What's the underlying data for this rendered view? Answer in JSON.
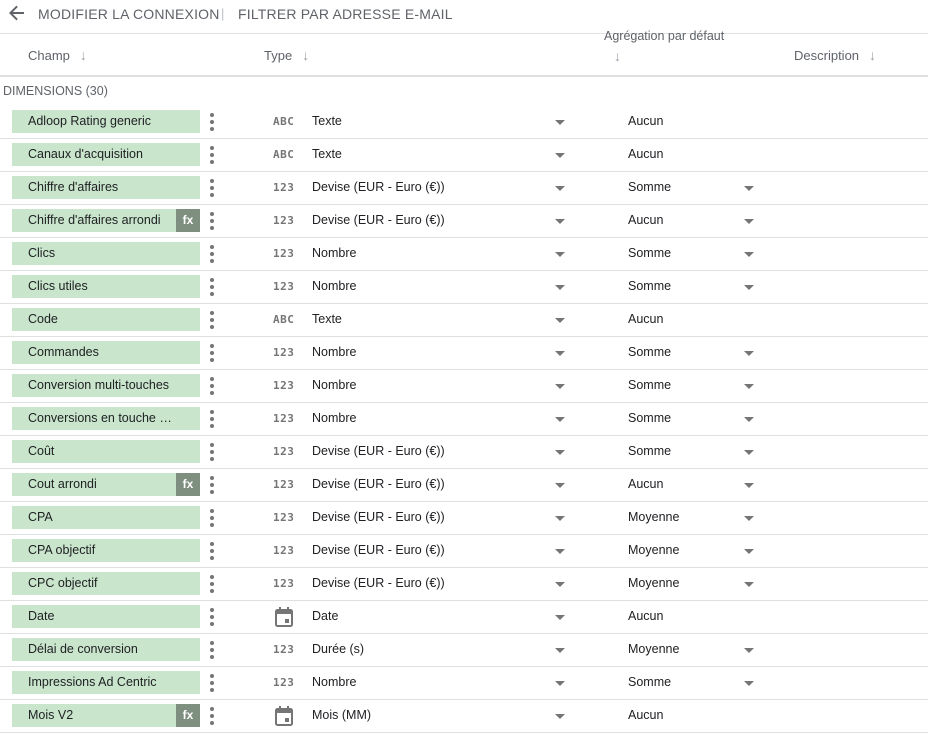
{
  "topbar": {
    "back_icon": "arrow-left-icon",
    "edit_connection": "MODIFIER LA CONNEXION",
    "separator": "|",
    "filter_email": "FILTRER PAR ADRESSE E-MAIL"
  },
  "columns": {
    "field": "Champ",
    "type": "Type",
    "aggregation": "Agrégation par défaut",
    "description": "Description",
    "sort_icon": "↓"
  },
  "section_label": "DIMENSIONS (30)",
  "colors": {
    "chip": "#c9e6cc",
    "fx_badge": "#7e8f80"
  },
  "rows": [
    {
      "field": "Adloop Rating generic",
      "fx": "",
      "icon": "ABC",
      "type": "Texte",
      "agg": "Aucun",
      "agg_dropdown": false
    },
    {
      "field": "Canaux d'acquisition",
      "fx": "",
      "icon": "ABC",
      "type": "Texte",
      "agg": "Aucun",
      "agg_dropdown": false
    },
    {
      "field": "Chiffre d'affaires",
      "fx": "",
      "icon": "123",
      "type": "Devise (EUR - Euro (€))",
      "agg": "Somme",
      "agg_dropdown": true
    },
    {
      "field": "Chiffre d'affaires arrondi",
      "fx": "fx",
      "icon": "123",
      "type": "Devise (EUR - Euro (€))",
      "agg": "Aucun",
      "agg_dropdown": true
    },
    {
      "field": "Clics",
      "fx": "",
      "icon": "123",
      "type": "Nombre",
      "agg": "Somme",
      "agg_dropdown": true
    },
    {
      "field": "Clics utiles",
      "fx": "",
      "icon": "123",
      "type": "Nombre",
      "agg": "Somme",
      "agg_dropdown": true
    },
    {
      "field": "Code",
      "fx": "",
      "icon": "ABC",
      "type": "Texte",
      "agg": "Aucun",
      "agg_dropdown": false
    },
    {
      "field": "Commandes",
      "fx": "",
      "icon": "123",
      "type": "Nombre",
      "agg": "Somme",
      "agg_dropdown": true
    },
    {
      "field": "Conversion multi-touches",
      "fx": "",
      "icon": "123",
      "type": "Nombre",
      "agg": "Somme",
      "agg_dropdown": true
    },
    {
      "field": "Conversions en touche un…",
      "fx": "",
      "icon": "123",
      "type": "Nombre",
      "agg": "Somme",
      "agg_dropdown": true
    },
    {
      "field": "Coût",
      "fx": "",
      "icon": "123",
      "type": "Devise (EUR - Euro (€))",
      "agg": "Somme",
      "agg_dropdown": true
    },
    {
      "field": "Cout arrondi",
      "fx": "fx",
      "icon": "123",
      "type": "Devise (EUR - Euro (€))",
      "agg": "Aucun",
      "agg_dropdown": true
    },
    {
      "field": "CPA",
      "fx": "",
      "icon": "123",
      "type": "Devise (EUR - Euro (€))",
      "agg": "Moyenne",
      "agg_dropdown": true
    },
    {
      "field": "CPA objectif",
      "fx": "",
      "icon": "123",
      "type": "Devise (EUR - Euro (€))",
      "agg": "Moyenne",
      "agg_dropdown": true
    },
    {
      "field": "CPC objectif",
      "fx": "",
      "icon": "123",
      "type": "Devise (EUR - Euro (€))",
      "agg": "Moyenne",
      "agg_dropdown": true
    },
    {
      "field": "Date",
      "fx": "",
      "icon": "calendar-icon",
      "type": "Date",
      "agg": "Aucun",
      "agg_dropdown": false
    },
    {
      "field": "Délai de conversion",
      "fx": "",
      "icon": "123",
      "type": "Durée (s)",
      "agg": "Moyenne",
      "agg_dropdown": true
    },
    {
      "field": "Impressions Ad Centric",
      "fx": "",
      "icon": "123",
      "type": "Nombre",
      "agg": "Somme",
      "agg_dropdown": true
    },
    {
      "field": "Mois V2",
      "fx": "fx",
      "icon": "calendar-icon",
      "type": "Mois (MM)",
      "agg": "Aucun",
      "agg_dropdown": false
    }
  ]
}
